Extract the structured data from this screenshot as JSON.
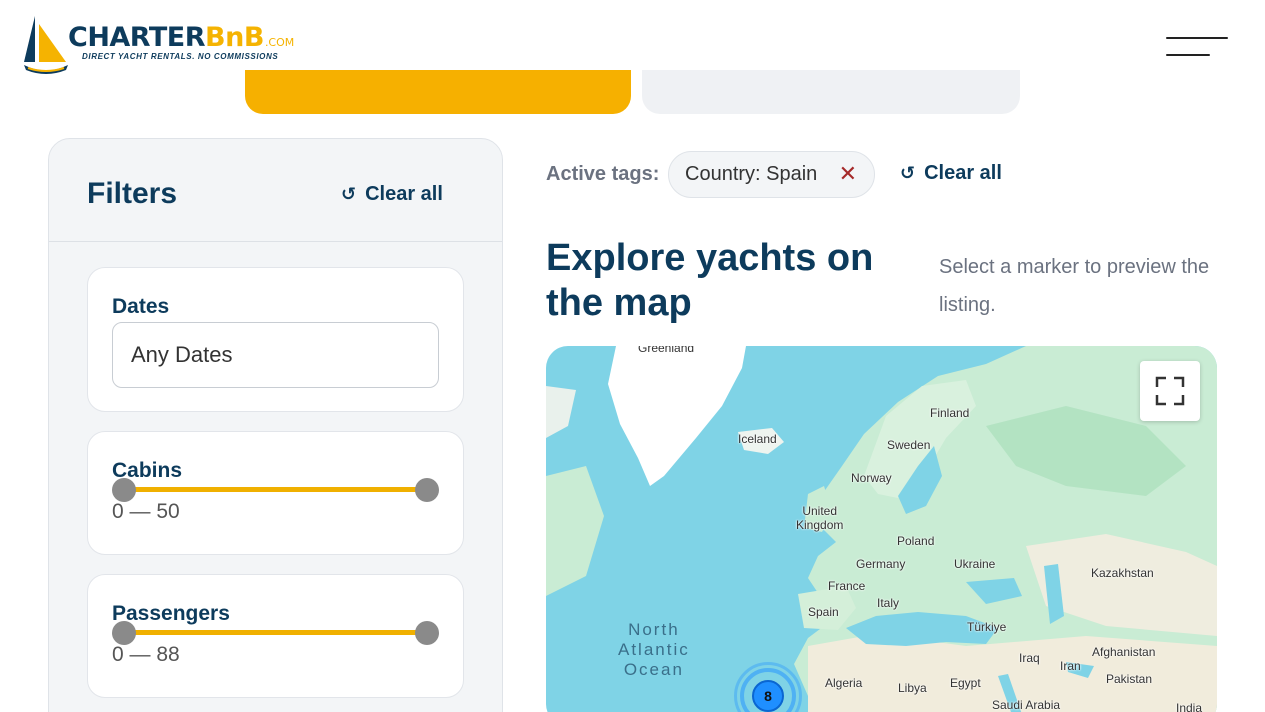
{
  "header": {
    "logo": {
      "name": "CHARTER",
      "name_accent": "BnB",
      "suffix": ".COM",
      "tagline": "DIRECT YACHT RENTALS.  NO COMMISSIONS"
    },
    "menu_icon": "hamburger-icon"
  },
  "filters": {
    "title": "Filters",
    "clear_all": "Clear all",
    "dates": {
      "label": "Dates",
      "value": "Any Dates"
    },
    "cabins": {
      "label": "Cabins",
      "range_text": "0 — 50",
      "min": 0,
      "max": 50
    },
    "passengers": {
      "label": "Passengers",
      "range_text": "0 — 88",
      "min": 0,
      "max": 88
    }
  },
  "active_tags": {
    "label": "Active tags:",
    "tags": [
      {
        "key": "Country:",
        "value": "Spain"
      }
    ],
    "clear_all": "Clear all"
  },
  "explore": {
    "title": "Explore yachts on the map",
    "subtitle": "Select a marker to preview the listing."
  },
  "map": {
    "labels": [
      "Greenland",
      "Iceland",
      "Finland",
      "Sweden",
      "Norway",
      "United Kingdom",
      "Poland",
      "Germany",
      "Ukraine",
      "Kazakhstan",
      "France",
      "Italy",
      "Spain",
      "Türkiye",
      "Iraq",
      "Iran",
      "Afghanistan",
      "Pakistan",
      "Algeria",
      "Libya",
      "Egypt",
      "Saudi Arabia",
      "India"
    ],
    "ocean": [
      "North",
      "Atlantic",
      "Ocean"
    ],
    "cluster_count": "8",
    "fullscreen_icon": "fullscreen-icon"
  },
  "colors": {
    "brand_navy": "#0d3b5c",
    "brand_yellow": "#f5b301",
    "water": "#7fd3e6",
    "land": "#c9ecd4"
  }
}
